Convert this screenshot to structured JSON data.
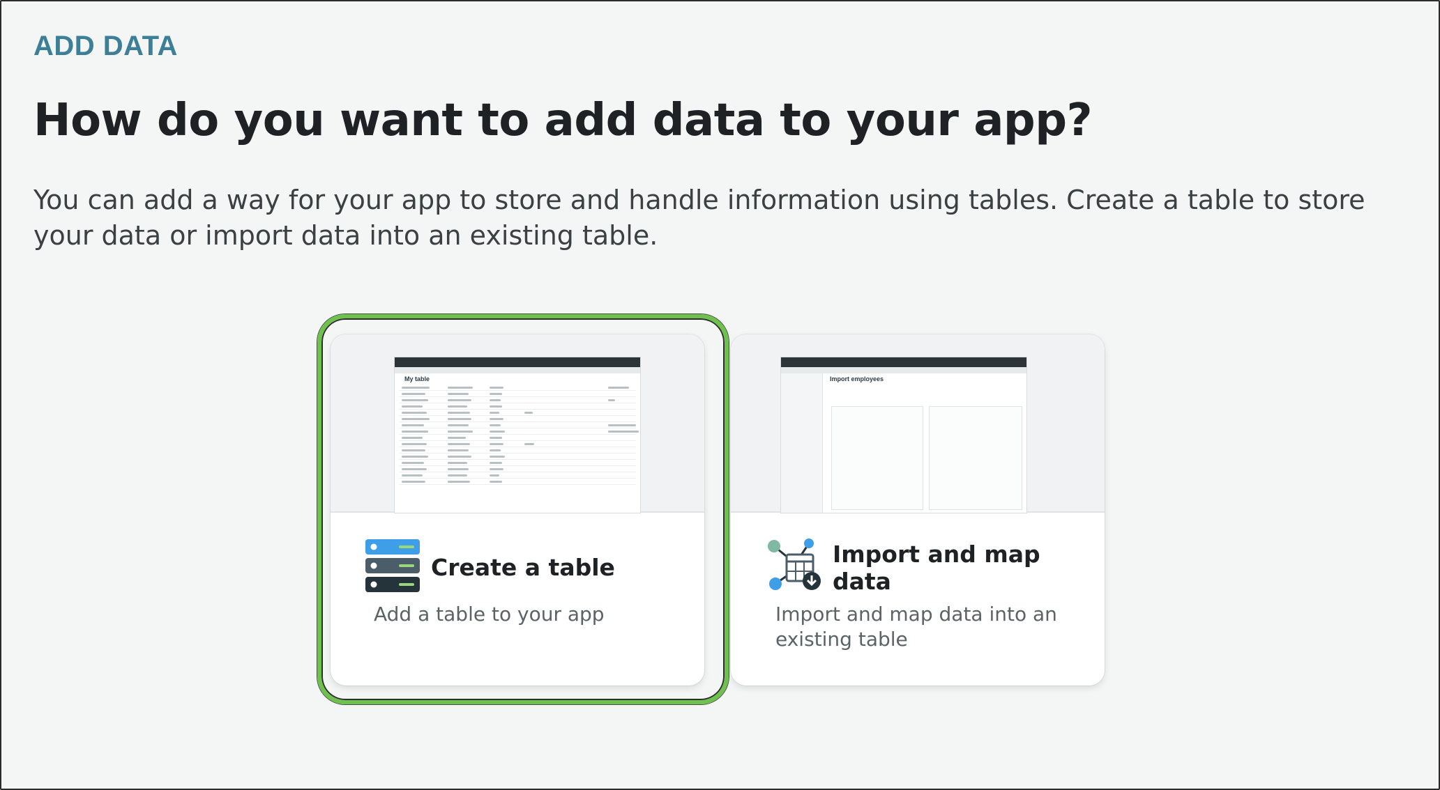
{
  "header": {
    "eyebrow": "ADD DATA",
    "title": "How do you want to add data to your app?",
    "description": "You can add a way for your app to store and handle information using tables. Create a table to store your data or import data into an existing table."
  },
  "options": [
    {
      "id": "create-table",
      "title": "Create a table",
      "description": "Add a table to your app",
      "icon": "server-stack-icon",
      "selected": true,
      "thumbnail_title": "My table"
    },
    {
      "id": "import-map",
      "title": "Import and map data",
      "description": "Import and map data into an existing table",
      "icon": "import-map-icon",
      "selected": false,
      "thumbnail_title": "Import employees"
    }
  ],
  "colors": {
    "accent": "#3d7f96",
    "selected_border": "#6cc24a",
    "background": "#f4f6f6"
  }
}
